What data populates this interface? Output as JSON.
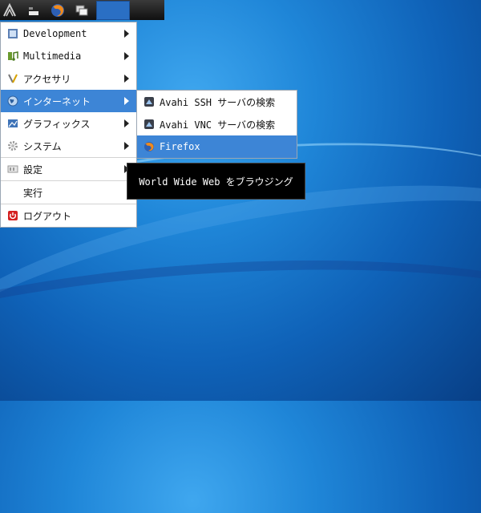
{
  "taskbar": {
    "buttons": [
      {
        "icon": "lxde-logo-icon"
      },
      {
        "icon": "minimize-all-icon"
      },
      {
        "icon": "firefox-icon"
      },
      {
        "icon": "window-switcher-icon"
      }
    ]
  },
  "main_menu": {
    "items": [
      {
        "label": "Development",
        "icon": "development-icon",
        "has_submenu": true
      },
      {
        "label": "Multimedia",
        "icon": "multimedia-icon",
        "has_submenu": true
      },
      {
        "label": "アクセサリ",
        "icon": "accessories-icon",
        "has_submenu": true
      },
      {
        "label": "インターネット",
        "icon": "internet-icon",
        "has_submenu": true,
        "active": true
      },
      {
        "label": "グラフィックス",
        "icon": "graphics-icon",
        "has_submenu": true
      },
      {
        "label": "システム",
        "icon": "system-icon",
        "has_submenu": true
      },
      {
        "label": "設定",
        "icon": "preferences-icon",
        "has_submenu": true
      },
      {
        "label": "実行",
        "icon": "",
        "has_submenu": false
      },
      {
        "label": "ログアウト",
        "icon": "logout-icon",
        "has_submenu": false
      }
    ]
  },
  "internet_submenu": {
    "items": [
      {
        "label": "Avahi SSH サーバの検索",
        "icon": "avahi-icon"
      },
      {
        "label": "Avahi VNC サーバの検索",
        "icon": "avahi-icon"
      },
      {
        "label": "Firefox",
        "icon": "firefox-icon",
        "active": true
      }
    ]
  },
  "tooltip": {
    "text": "World Wide Web をブラウジング"
  },
  "colors": {
    "menu_highlight": "#3d85d6",
    "desktop_blue": "#1f86d8",
    "tooltip_bg": "#000000"
  }
}
